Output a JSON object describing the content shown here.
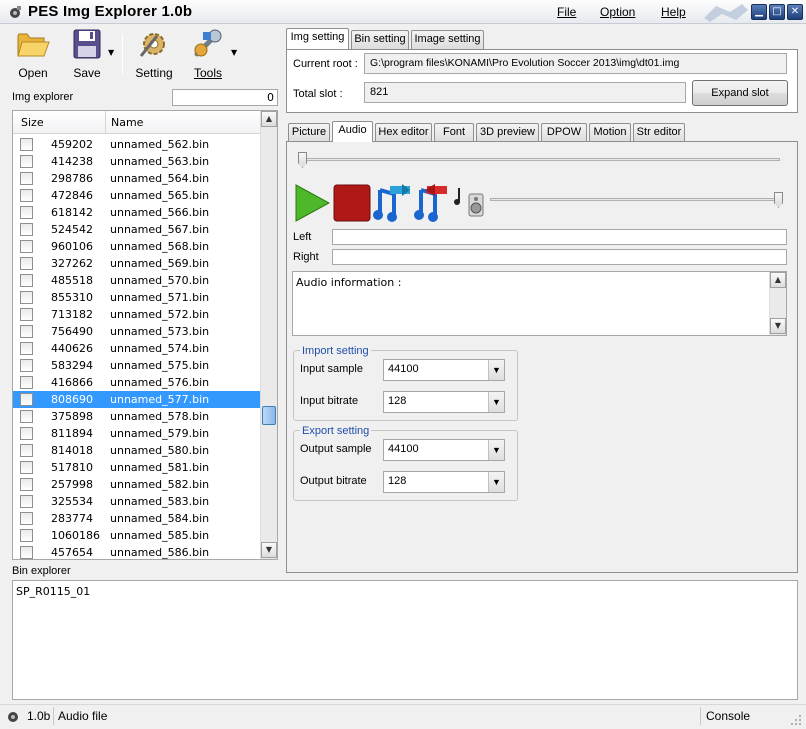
{
  "window": {
    "title": "PES Img Explorer 1.0b",
    "menu": [
      {
        "label": "File",
        "key": "F"
      },
      {
        "label": "Option",
        "key": "O"
      },
      {
        "label": "Help",
        "key": "H"
      }
    ],
    "controls": {
      "minimize": "▁",
      "maximize": "□",
      "close": "✕"
    }
  },
  "toolbar": {
    "open": "Open",
    "save": "Save",
    "setting": "Setting",
    "tools": "Tools"
  },
  "img_explorer": {
    "label": "Img explorer",
    "filter_value": "0",
    "columns": {
      "size": "Size",
      "name": "Name"
    },
    "rows": [
      {
        "size": "459202",
        "name": "unnamed_562.bin",
        "selected": false
      },
      {
        "size": "414238",
        "name": "unnamed_563.bin",
        "selected": false
      },
      {
        "size": "298786",
        "name": "unnamed_564.bin",
        "selected": false
      },
      {
        "size": "472846",
        "name": "unnamed_565.bin",
        "selected": false
      },
      {
        "size": "618142",
        "name": "unnamed_566.bin",
        "selected": false
      },
      {
        "size": "524542",
        "name": "unnamed_567.bin",
        "selected": false
      },
      {
        "size": "960106",
        "name": "unnamed_568.bin",
        "selected": false
      },
      {
        "size": "327262",
        "name": "unnamed_569.bin",
        "selected": false
      },
      {
        "size": "485518",
        "name": "unnamed_570.bin",
        "selected": false
      },
      {
        "size": "855310",
        "name": "unnamed_571.bin",
        "selected": false
      },
      {
        "size": "713182",
        "name": "unnamed_572.bin",
        "selected": false
      },
      {
        "size": "756490",
        "name": "unnamed_573.bin",
        "selected": false
      },
      {
        "size": "440626",
        "name": "unnamed_574.bin",
        "selected": false
      },
      {
        "size": "583294",
        "name": "unnamed_575.bin",
        "selected": false
      },
      {
        "size": "416866",
        "name": "unnamed_576.bin",
        "selected": false
      },
      {
        "size": "808690",
        "name": "unnamed_577.bin",
        "selected": true
      },
      {
        "size": "375898",
        "name": "unnamed_578.bin",
        "selected": false
      },
      {
        "size": "811894",
        "name": "unnamed_579.bin",
        "selected": false
      },
      {
        "size": "814018",
        "name": "unnamed_580.bin",
        "selected": false
      },
      {
        "size": "517810",
        "name": "unnamed_581.bin",
        "selected": false
      },
      {
        "size": "257998",
        "name": "unnamed_582.bin",
        "selected": false
      },
      {
        "size": "325534",
        "name": "unnamed_583.bin",
        "selected": false
      },
      {
        "size": "283774",
        "name": "unnamed_584.bin",
        "selected": false
      },
      {
        "size": "1060186",
        "name": "unnamed_585.bin",
        "selected": false
      },
      {
        "size": "457654",
        "name": "unnamed_586.bin",
        "selected": false
      }
    ]
  },
  "bin_explorer": {
    "label": "Bin explorer",
    "content": "SP_R0115_01"
  },
  "settings_tabs": [
    "Img setting",
    "Bin setting",
    "Image setting"
  ],
  "img_setting": {
    "current_root_label": "Current root :",
    "current_root_value": "G:\\program files\\KONAMI\\Pro Evolution Soccer 2013\\img\\dt01.img",
    "total_slot_label": "Total slot :",
    "total_slot_value": "821",
    "expand_button": "Expand slot"
  },
  "content_tabs": [
    "Picture",
    "Audio",
    "Hex editor",
    "Font",
    "3D preview",
    "DPOW",
    "Motion",
    "Str editor"
  ],
  "audio": {
    "left_label": "Left",
    "right_label": "Right",
    "info_label": "Audio information :",
    "import_group": "Import setting",
    "input_sample_label": "Input sample",
    "input_sample_value": "44100",
    "input_bitrate_label": "Input bitrate",
    "input_bitrate_value": "128",
    "export_group": "Export setting",
    "output_sample_label": "Output sample",
    "output_sample_value": "44100",
    "output_bitrate_label": "Output bitrate",
    "output_bitrate_value": "128"
  },
  "statusbar": {
    "version": "1.0b",
    "file_type": "Audio file",
    "console": "Console"
  }
}
